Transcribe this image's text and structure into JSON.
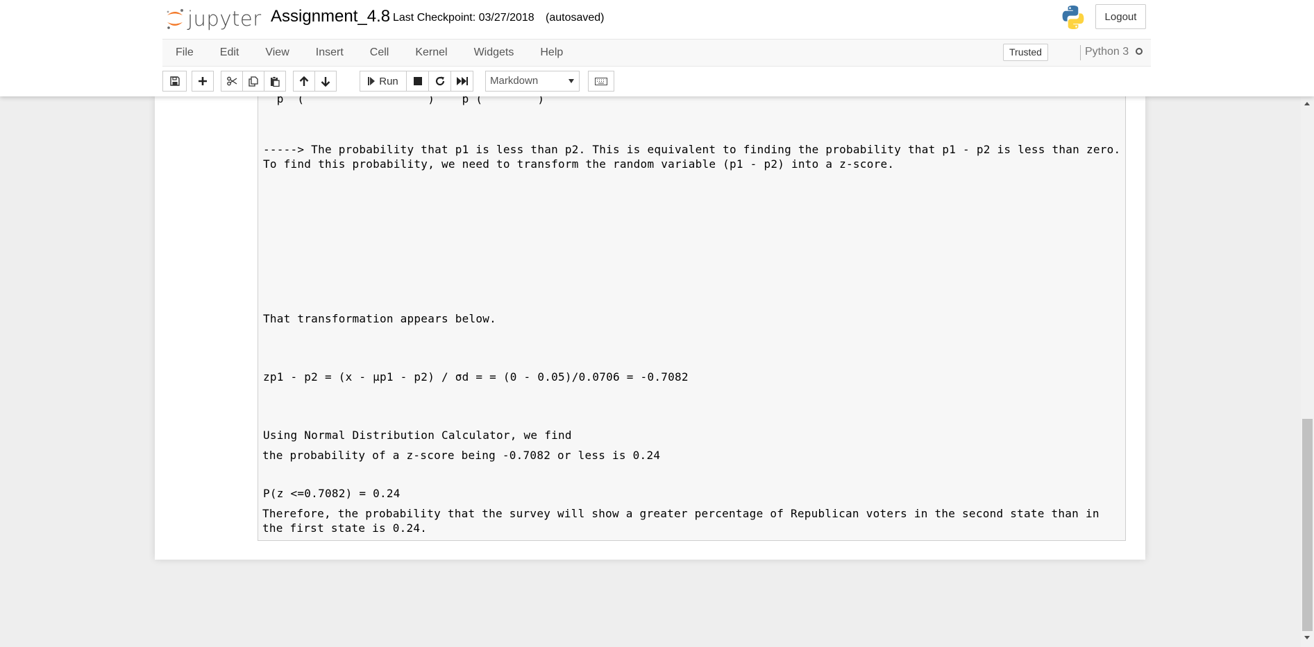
{
  "header": {
    "logo_text": "jupyter",
    "notebook_title": "Assignment_4.8",
    "checkpoint": "Last Checkpoint: 03/27/2018",
    "autosave_status": "(autosaved)",
    "logout_label": "Logout"
  },
  "menubar": {
    "items": [
      "File",
      "Edit",
      "View",
      "Insert",
      "Cell",
      "Kernel",
      "Widgets",
      "Help"
    ],
    "trusted_label": "Trusted",
    "kernel_name": "Python 3"
  },
  "toolbar": {
    "run_label": "Run",
    "cell_type": "Markdown"
  },
  "cell": {
    "lines": [
      "-----> The probability that p1 is less than p2. This is equivalent to finding the probability that p1 - p2 is less than zero. To find this probability, we need to transform the random variable (p1 - p2) into a z-score.",
      "That transformation appears below.",
      "zp1 - p2 = (x - μp1 - p2) / σd = = (0 - 0.05)/0.0706 = -0.7082",
      "Using Normal Distribution Calculator, we find",
      "P(z <=0.7082) = 0.24",
      "the probability of a z-score being -0.7082 or less is 0.24",
      "Therefore, the probability that the survey will show a greater percentage of Republican voters in the second state than in the first state is 0.24."
    ]
  },
  "colors": {
    "jupyter_orange": "#f37726",
    "header_bg": "#ffffff",
    "page_bg": "#eeeeee",
    "cell_bg": "#f7f7f7"
  }
}
